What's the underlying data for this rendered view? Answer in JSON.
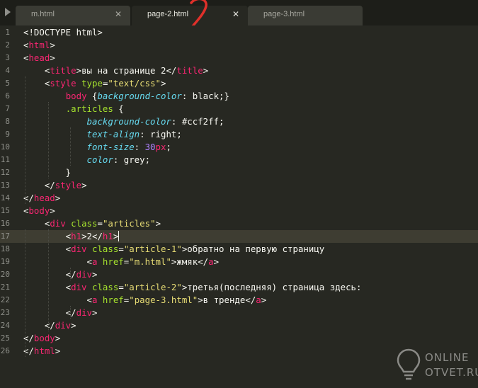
{
  "tabs": [
    {
      "label": "m.html",
      "active": false
    },
    {
      "label": "page-2.html",
      "active": true
    },
    {
      "label": "page-3.html",
      "active": false
    }
  ],
  "tab_nav_icon": "triangle-left-icon",
  "tab_close_icon": "close-icon",
  "annotation": "2",
  "watermark": {
    "line1": "ONLINE",
    "line2": "OTVET.RU"
  },
  "editor": {
    "current_line": 17,
    "lines": [
      {
        "num": "1",
        "tokens": [
          {
            "t": "<!DOCTYPE html>",
            "c": "txt"
          }
        ]
      },
      {
        "num": "2",
        "tokens": [
          {
            "t": "<",
            "c": "txt"
          },
          {
            "t": "html",
            "c": "tg"
          },
          {
            "t": ">",
            "c": "txt"
          }
        ]
      },
      {
        "num": "3",
        "tokens": [
          {
            "t": "<",
            "c": "txt"
          },
          {
            "t": "head",
            "c": "tg"
          },
          {
            "t": ">",
            "c": "txt"
          }
        ]
      },
      {
        "num": "4",
        "tokens": [
          {
            "t": "    <",
            "c": "txt"
          },
          {
            "t": "title",
            "c": "tg"
          },
          {
            "t": ">вы на странице 2</",
            "c": "txt"
          },
          {
            "t": "title",
            "c": "tg"
          },
          {
            "t": ">",
            "c": "txt"
          }
        ]
      },
      {
        "num": "5",
        "tokens": [
          {
            "t": "    <",
            "c": "txt"
          },
          {
            "t": "style",
            "c": "tg"
          },
          {
            "t": " ",
            "c": "txt"
          },
          {
            "t": "type",
            "c": "at"
          },
          {
            "t": "=",
            "c": "txt"
          },
          {
            "t": "\"text/css\"",
            "c": "st"
          },
          {
            "t": ">",
            "c": "txt"
          }
        ]
      },
      {
        "num": "6",
        "tokens": [
          {
            "t": "        ",
            "c": "txt"
          },
          {
            "t": "body",
            "c": "tg"
          },
          {
            "t": " {",
            "c": "txt"
          },
          {
            "t": "background-color",
            "c": "pr"
          },
          {
            "t": ": ",
            "c": "txt"
          },
          {
            "t": "black",
            "c": "txt"
          },
          {
            "t": ";}",
            "c": "txt"
          }
        ]
      },
      {
        "num": "7",
        "tokens": [
          {
            "t": "        ",
            "c": "txt"
          },
          {
            "t": ".articles",
            "c": "at"
          },
          {
            "t": " {",
            "c": "txt"
          }
        ]
      },
      {
        "num": "8",
        "tokens": [
          {
            "t": "            ",
            "c": "txt"
          },
          {
            "t": "background-color",
            "c": "pr"
          },
          {
            "t": ": ",
            "c": "txt"
          },
          {
            "t": "#ccf2ff",
            "c": "txt"
          },
          {
            "t": ";",
            "c": "txt"
          }
        ]
      },
      {
        "num": "9",
        "tokens": [
          {
            "t": "            ",
            "c": "txt"
          },
          {
            "t": "text-align",
            "c": "pr"
          },
          {
            "t": ": ",
            "c": "txt"
          },
          {
            "t": "right",
            "c": "txt"
          },
          {
            "t": ";",
            "c": "txt"
          }
        ]
      },
      {
        "num": "10",
        "tokens": [
          {
            "t": "            ",
            "c": "txt"
          },
          {
            "t": "font-size",
            "c": "pr"
          },
          {
            "t": ": ",
            "c": "txt"
          },
          {
            "t": "30",
            "c": "nm"
          },
          {
            "t": "px",
            "c": "un"
          },
          {
            "t": ";",
            "c": "txt"
          }
        ]
      },
      {
        "num": "11",
        "tokens": [
          {
            "t": "            ",
            "c": "txt"
          },
          {
            "t": "color",
            "c": "pr"
          },
          {
            "t": ": ",
            "c": "txt"
          },
          {
            "t": "grey",
            "c": "txt"
          },
          {
            "t": ";",
            "c": "txt"
          }
        ]
      },
      {
        "num": "12",
        "tokens": [
          {
            "t": "        }",
            "c": "txt"
          }
        ]
      },
      {
        "num": "13",
        "tokens": [
          {
            "t": "    </",
            "c": "txt"
          },
          {
            "t": "style",
            "c": "tg"
          },
          {
            "t": ">",
            "c": "txt"
          }
        ]
      },
      {
        "num": "14",
        "tokens": [
          {
            "t": "</",
            "c": "txt"
          },
          {
            "t": "head",
            "c": "tg"
          },
          {
            "t": ">",
            "c": "txt"
          }
        ]
      },
      {
        "num": "15",
        "tokens": [
          {
            "t": "<",
            "c": "txt"
          },
          {
            "t": "body",
            "c": "tg"
          },
          {
            "t": ">",
            "c": "txt"
          }
        ]
      },
      {
        "num": "16",
        "tokens": [
          {
            "t": "    <",
            "c": "txt"
          },
          {
            "t": "div",
            "c": "tg"
          },
          {
            "t": " ",
            "c": "txt"
          },
          {
            "t": "class",
            "c": "at"
          },
          {
            "t": "=",
            "c": "txt"
          },
          {
            "t": "\"articles\"",
            "c": "st"
          },
          {
            "t": ">",
            "c": "txt"
          }
        ]
      },
      {
        "num": "17",
        "tokens": [
          {
            "t": "        <",
            "c": "txt"
          },
          {
            "t": "h1",
            "c": "tg"
          },
          {
            "t": ">2</",
            "c": "txt"
          },
          {
            "t": "h1",
            "c": "tg"
          },
          {
            "t": ">",
            "c": "txt"
          }
        ]
      },
      {
        "num": "18",
        "tokens": [
          {
            "t": "        <",
            "c": "txt"
          },
          {
            "t": "div",
            "c": "tg"
          },
          {
            "t": " ",
            "c": "txt"
          },
          {
            "t": "class",
            "c": "at"
          },
          {
            "t": "=",
            "c": "txt"
          },
          {
            "t": "\"article-1\"",
            "c": "st"
          },
          {
            "t": ">обратно на первую страницу",
            "c": "txt"
          }
        ]
      },
      {
        "num": "19",
        "tokens": [
          {
            "t": "            <",
            "c": "txt"
          },
          {
            "t": "a",
            "c": "tg"
          },
          {
            "t": " ",
            "c": "txt"
          },
          {
            "t": "href",
            "c": "at"
          },
          {
            "t": "=",
            "c": "txt"
          },
          {
            "t": "\"m.html\"",
            "c": "st"
          },
          {
            "t": ">жмяк</",
            "c": "txt"
          },
          {
            "t": "a",
            "c": "tg"
          },
          {
            "t": ">",
            "c": "txt"
          }
        ]
      },
      {
        "num": "20",
        "tokens": [
          {
            "t": "        </",
            "c": "txt"
          },
          {
            "t": "div",
            "c": "tg"
          },
          {
            "t": ">",
            "c": "txt"
          }
        ]
      },
      {
        "num": "21",
        "tokens": [
          {
            "t": "        <",
            "c": "txt"
          },
          {
            "t": "div",
            "c": "tg"
          },
          {
            "t": " ",
            "c": "txt"
          },
          {
            "t": "class",
            "c": "at"
          },
          {
            "t": "=",
            "c": "txt"
          },
          {
            "t": "\"article-2\"",
            "c": "st"
          },
          {
            "t": ">третья(последняя) страница здесь:",
            "c": "txt"
          }
        ]
      },
      {
        "num": "22",
        "tokens": [
          {
            "t": "            <",
            "c": "txt"
          },
          {
            "t": "a",
            "c": "tg"
          },
          {
            "t": " ",
            "c": "txt"
          },
          {
            "t": "href",
            "c": "at"
          },
          {
            "t": "=",
            "c": "txt"
          },
          {
            "t": "\"page-3.html\"",
            "c": "st"
          },
          {
            "t": ">в тренде</",
            "c": "txt"
          },
          {
            "t": "a",
            "c": "tg"
          },
          {
            "t": ">",
            "c": "txt"
          }
        ]
      },
      {
        "num": "23",
        "tokens": [
          {
            "t": "        </",
            "c": "txt"
          },
          {
            "t": "div",
            "c": "tg"
          },
          {
            "t": ">",
            "c": "txt"
          }
        ]
      },
      {
        "num": "24",
        "tokens": [
          {
            "t": "    </",
            "c": "txt"
          },
          {
            "t": "div",
            "c": "tg"
          },
          {
            "t": ">",
            "c": "txt"
          }
        ]
      },
      {
        "num": "25",
        "tokens": [
          {
            "t": "</",
            "c": "txt"
          },
          {
            "t": "body",
            "c": "tg"
          },
          {
            "t": ">",
            "c": "txt"
          }
        ]
      },
      {
        "num": "26",
        "tokens": [
          {
            "t": "</",
            "c": "txt"
          },
          {
            "t": "html",
            "c": "tg"
          },
          {
            "t": ">",
            "c": "txt"
          }
        ]
      }
    ]
  }
}
